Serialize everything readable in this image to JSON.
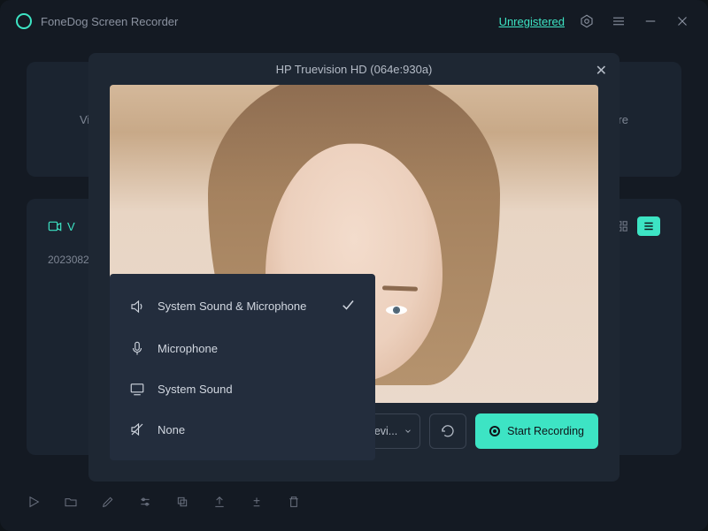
{
  "app": {
    "title": "FoneDog Screen Recorder",
    "unregistered": "Unregistered"
  },
  "bgPanel": {
    "leftText": "Vid",
    "rightText": "ure"
  },
  "gallery": {
    "tabLabel": "V",
    "dateText": "2023082"
  },
  "modal": {
    "cameraTitle": "HP Truevision HD (064e:930a)"
  },
  "dropdown": {
    "items": [
      {
        "label": "System Sound & Microphone",
        "checked": true
      },
      {
        "label": "Microphone",
        "checked": false
      },
      {
        "label": "System Sound",
        "checked": false
      },
      {
        "label": "None",
        "checked": false
      }
    ]
  },
  "footer": {
    "audioSelected": "System Sound & Microphone",
    "camSelected": "HP Truevi...",
    "startLabel": "Start Recording"
  }
}
